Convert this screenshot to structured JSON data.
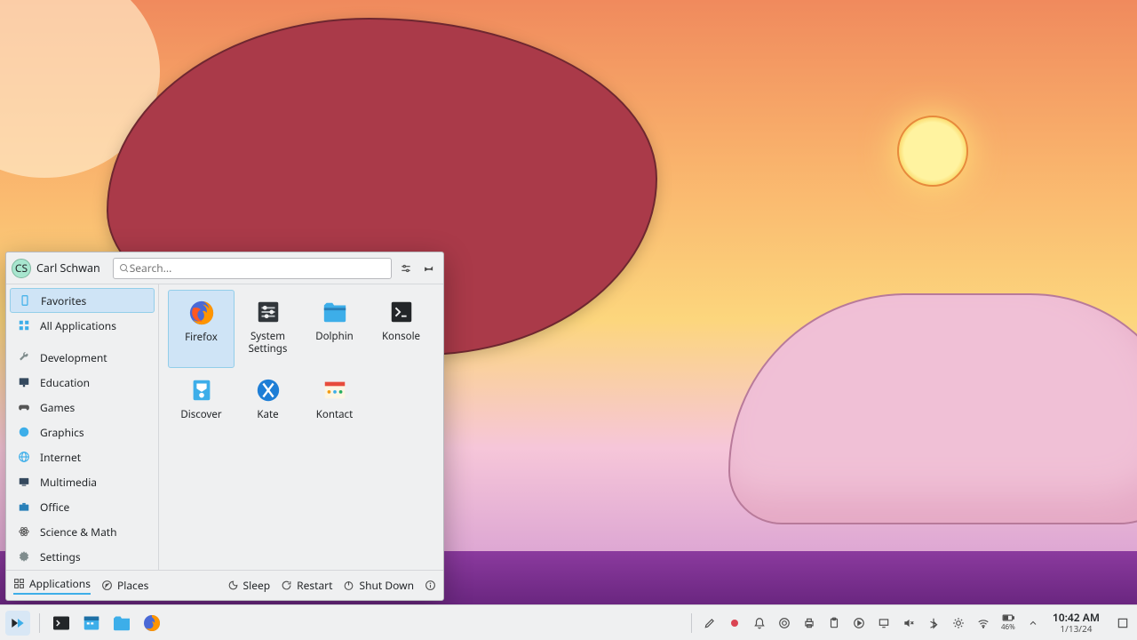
{
  "user": {
    "name": "Carl Schwan",
    "initials": "CS"
  },
  "search": {
    "placeholder": "Search..."
  },
  "sidebar": {
    "top": [
      {
        "label": "Favorites",
        "icon": "bookmark"
      },
      {
        "label": "All Applications",
        "icon": "grid"
      }
    ],
    "categories": [
      {
        "label": "Development",
        "icon": "wrench"
      },
      {
        "label": "Education",
        "icon": "board"
      },
      {
        "label": "Games",
        "icon": "gamepad"
      },
      {
        "label": "Graphics",
        "icon": "globe"
      },
      {
        "label": "Internet",
        "icon": "globe2"
      },
      {
        "label": "Multimedia",
        "icon": "tv"
      },
      {
        "label": "Office",
        "icon": "briefcase"
      },
      {
        "label": "Science & Math",
        "icon": "atom"
      },
      {
        "label": "Settings",
        "icon": "gear"
      }
    ]
  },
  "favorites": [
    {
      "label": "Firefox",
      "icon": "firefox"
    },
    {
      "label": "System Settings",
      "icon": "settings"
    },
    {
      "label": "Dolphin",
      "icon": "dolphin"
    },
    {
      "label": "Konsole",
      "icon": "konsole"
    },
    {
      "label": "Discover",
      "icon": "discover"
    },
    {
      "label": "Kate",
      "icon": "kate"
    },
    {
      "label": "Kontact",
      "icon": "kontact"
    }
  ],
  "footer": {
    "tabs": [
      {
        "label": "Applications"
      },
      {
        "label": "Places"
      }
    ],
    "power": [
      {
        "label": "Sleep"
      },
      {
        "label": "Restart"
      },
      {
        "label": "Shut Down"
      }
    ]
  },
  "taskbar": {
    "pinned": [
      "launcher",
      "terminal",
      "calendar",
      "dolphin",
      "firefox"
    ]
  },
  "tray": {
    "battery": "46%"
  },
  "clock": {
    "time": "10:42 AM",
    "date": "1/13/24"
  }
}
